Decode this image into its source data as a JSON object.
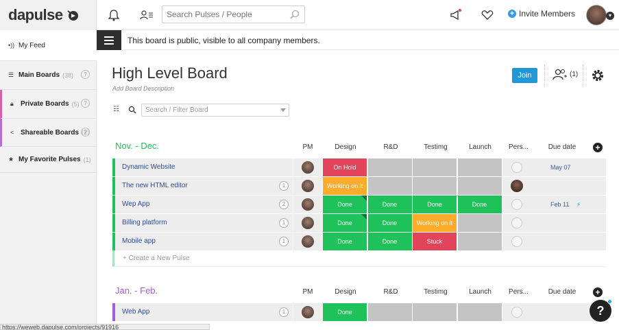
{
  "app": {
    "logo": "dapulse"
  },
  "topbar": {
    "search_placeholder": "Search Pulses / People",
    "invite_label": "Invite Members"
  },
  "sidebar": {
    "items": [
      {
        "label": "My Feed",
        "count": ""
      },
      {
        "label": "Main Boards",
        "count": "(38)"
      },
      {
        "label": "Private Boards",
        "count": "(5)"
      },
      {
        "label": "Shareable Boards",
        "count": "(2)"
      },
      {
        "label": "My Favorite Pulses",
        "count": "(1)"
      }
    ],
    "help": "?"
  },
  "status_url": "https://weweb.dapulse.com/projects/91916",
  "notice": "This board is public, visible to all company members.",
  "board": {
    "title": "High Level Board",
    "description": "Add Board Description",
    "join_label": "Join",
    "members_count": "(1)",
    "filter_placeholder": "Search / Filter Board"
  },
  "columns": [
    "PM",
    "Design",
    "R&D",
    "Testimg",
    "Launch",
    "Pers...",
    "Due date"
  ],
  "colors": {
    "green": "#1fc25a",
    "orange": "#fcab2a",
    "red": "#e2445c",
    "gray": "#c4c4c4",
    "group1": "#1fc25a",
    "group2": "#a25ddc"
  },
  "groups": [
    {
      "title": "Nov. - Dec.",
      "rows": [
        {
          "name": "Dynamic Website",
          "updates": "",
          "cells": [
            {
              "t": "On Hold",
              "c": "red"
            },
            {
              "t": "",
              "c": "gray"
            },
            {
              "t": "",
              "c": "gray"
            },
            {
              "t": "",
              "c": "gray"
            }
          ],
          "person": "empty",
          "due": "May 07",
          "bolt": false
        },
        {
          "name": "The new HTML editor",
          "updates": "1",
          "cells": [
            {
              "t": "Working on it",
              "c": "orange"
            },
            {
              "t": "",
              "c": "gray"
            },
            {
              "t": "",
              "c": "gray"
            },
            {
              "t": "",
              "c": "gray"
            }
          ],
          "person": "photo",
          "due": "",
          "bolt": false
        },
        {
          "name": "Wep App",
          "updates": "2",
          "cells": [
            {
              "t": "Done",
              "c": "green",
              "flag": true
            },
            {
              "t": "Done",
              "c": "green"
            },
            {
              "t": "Done",
              "c": "green"
            },
            {
              "t": "Done",
              "c": "green"
            }
          ],
          "person": "empty",
          "due": "Feb 11",
          "bolt": true
        },
        {
          "name": "Billing platform",
          "updates": "1",
          "cells": [
            {
              "t": "Done",
              "c": "green",
              "flag": true
            },
            {
              "t": "Done",
              "c": "green"
            },
            {
              "t": "Working on it",
              "c": "orange"
            },
            {
              "t": "",
              "c": "gray"
            }
          ],
          "person": "empty",
          "due": "",
          "bolt": false
        },
        {
          "name": "Mobile app",
          "updates": "1",
          "cells": [
            {
              "t": "Done",
              "c": "green"
            },
            {
              "t": "Done",
              "c": "green"
            },
            {
              "t": "Stuck",
              "c": "red"
            },
            {
              "t": "",
              "c": "gray"
            }
          ],
          "person": "empty",
          "due": "",
          "bolt": false
        }
      ],
      "new_pulse": "+ Create a New Pulse"
    },
    {
      "title": "Jan. - Feb.",
      "rows": [
        {
          "name": "Web App",
          "updates": "1",
          "cells": [
            {
              "t": "Done",
              "c": "green"
            },
            {
              "t": "",
              "c": "gray"
            },
            {
              "t": "",
              "c": "gray"
            },
            {
              "t": "",
              "c": "gray"
            }
          ],
          "person": "empty",
          "due": "",
          "bolt": false
        }
      ]
    }
  ],
  "help_fab": "?"
}
